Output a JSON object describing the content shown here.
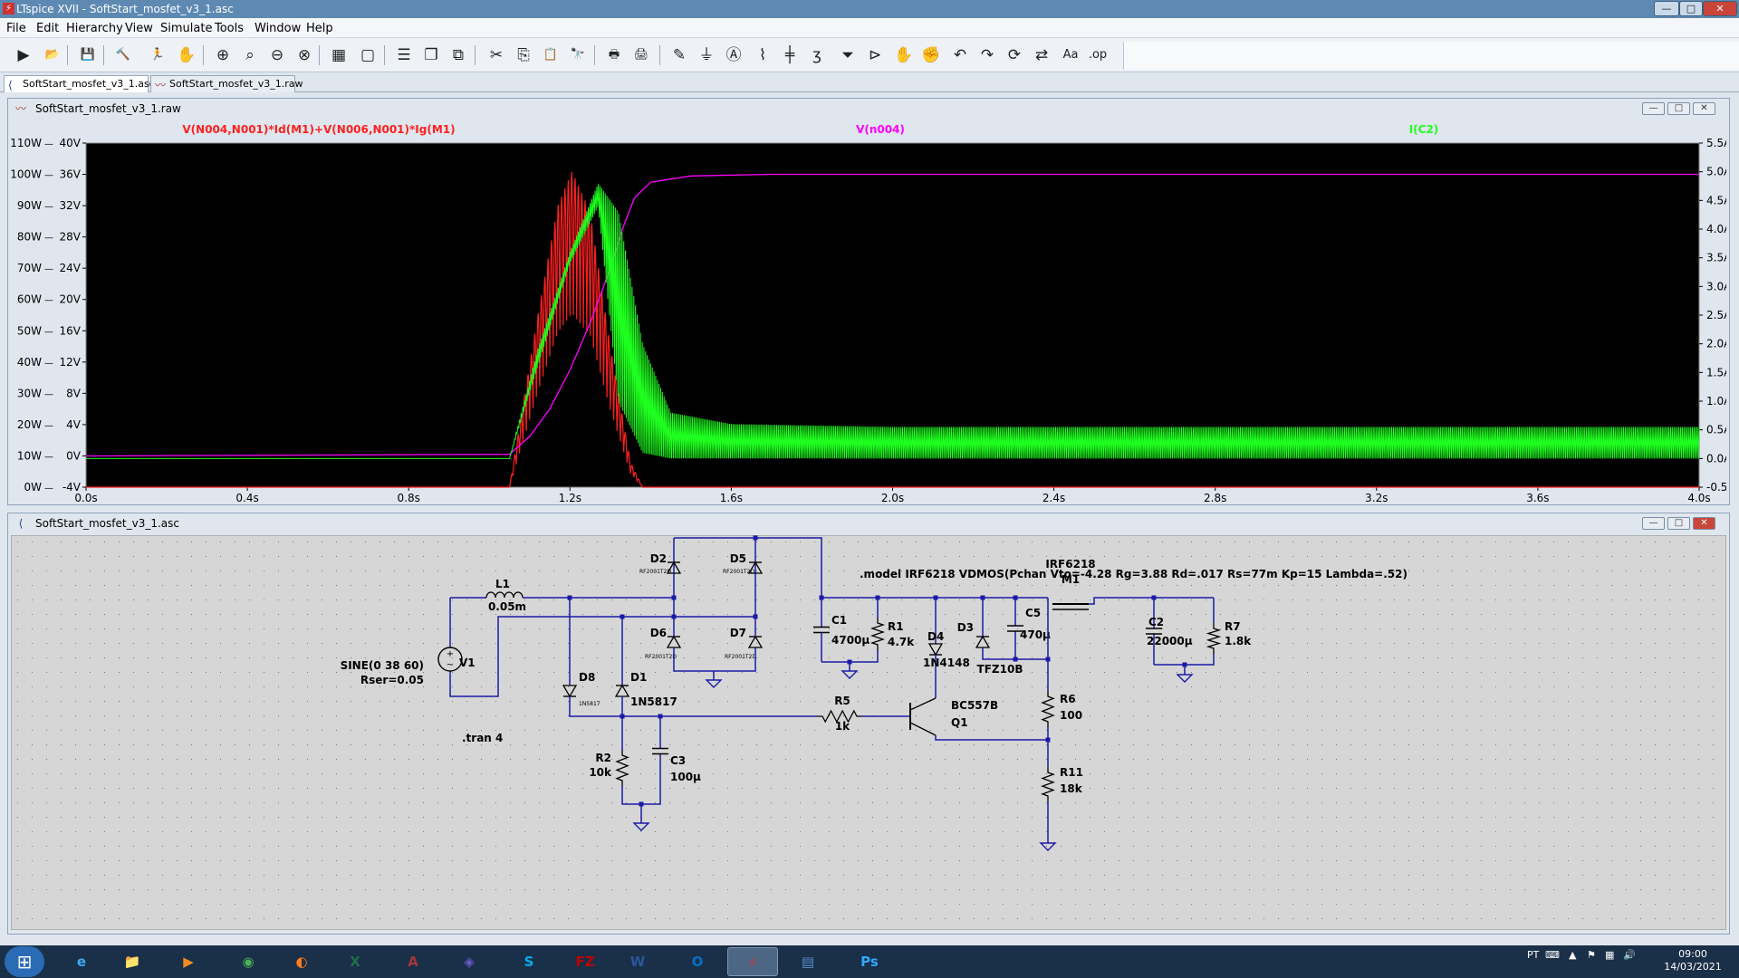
{
  "app": {
    "title": "LTspice XVII - SoftStart_mosfet_v3_1.asc",
    "icon": "ltspice-icon"
  },
  "window_controls": {
    "minimize": "—",
    "maximize": "□",
    "close": "✕"
  },
  "menu": [
    "File",
    "Edit",
    "Hierarchy",
    "View",
    "Simulate",
    "Tools",
    "Window",
    "Help"
  ],
  "toolbar": [
    {
      "name": "run-icon",
      "glyph": "▶"
    },
    {
      "name": "open-icon",
      "glyph": "📂"
    },
    {
      "name": "save-icon",
      "glyph": "💾"
    },
    {
      "name": "control-panel-icon",
      "glyph": "🔨"
    },
    {
      "name": "run-stop-icon",
      "glyph": "🏃"
    },
    {
      "name": "pan-icon",
      "glyph": "✋"
    },
    {
      "name": "zoom-in-icon",
      "glyph": "⊕"
    },
    {
      "name": "zoom-area-icon",
      "glyph": "⌕"
    },
    {
      "name": "zoom-out-icon",
      "glyph": "⊖"
    },
    {
      "name": "zoom-fit-icon",
      "glyph": "⊗"
    },
    {
      "name": "autorange-icon",
      "glyph": "▦"
    },
    {
      "name": "delete-plot-icon",
      "glyph": "▢"
    },
    {
      "name": "tile-horizontal-icon",
      "glyph": "☰"
    },
    {
      "name": "cascade-icon",
      "glyph": "❐"
    },
    {
      "name": "tile-vertical-icon",
      "glyph": "⧉"
    },
    {
      "name": "cut-icon",
      "glyph": "✂"
    },
    {
      "name": "copy-icon",
      "glyph": "⎘"
    },
    {
      "name": "paste-icon",
      "glyph": "📋"
    },
    {
      "name": "find-icon",
      "glyph": "🔭"
    },
    {
      "name": "print-icon",
      "glyph": "🖶"
    },
    {
      "name": "print-setup-icon",
      "glyph": "🖨"
    },
    {
      "name": "draw-wire-icon",
      "glyph": "✎"
    },
    {
      "name": "ground-icon",
      "glyph": "⏚"
    },
    {
      "name": "label-icon",
      "glyph": "Ⓐ"
    },
    {
      "name": "resistor-icon",
      "glyph": "⌇"
    },
    {
      "name": "capacitor-icon",
      "glyph": "╪"
    },
    {
      "name": "inductor-icon",
      "glyph": "ʒ"
    },
    {
      "name": "diode-icon",
      "glyph": "⏷"
    },
    {
      "name": "component-icon",
      "glyph": "⊳"
    },
    {
      "name": "move-icon",
      "glyph": "✋"
    },
    {
      "name": "drag-icon",
      "glyph": "✊"
    },
    {
      "name": "undo-icon",
      "glyph": "↶"
    },
    {
      "name": "redo-icon",
      "glyph": "↷"
    },
    {
      "name": "rotate-icon",
      "glyph": "⟳"
    },
    {
      "name": "mirror-icon",
      "glyph": "⇄"
    },
    {
      "name": "text-icon",
      "glyph": "Aa"
    },
    {
      "name": "spice-directive-icon",
      "glyph": ".op"
    }
  ],
  "tabs": [
    {
      "label": "SoftStart_mosfet_v3_1.asc",
      "active": true,
      "icon": "schematic-icon"
    },
    {
      "label": "SoftStart_mosfet_v3_1.raw",
      "active": false,
      "icon": "waveform-icon"
    }
  ],
  "plot_window": {
    "title": "SoftStart_mosfet_v3_1.raw"
  },
  "schematic_window": {
    "title": "SoftStart_mosfet_v3_1.asc"
  },
  "chart_data": {
    "type": "line",
    "title": "",
    "xlabel": "",
    "ylabel": "",
    "x_ticks": [
      "0.0s",
      "0.4s",
      "0.8s",
      "1.2s",
      "1.6s",
      "2.0s",
      "2.4s",
      "2.8s",
      "3.2s",
      "3.6s",
      "4.0s"
    ],
    "xlim": [
      0,
      4.0
    ],
    "y_left_ticks": [
      "0W",
      "10W",
      "20W",
      "30W",
      "40W",
      "50W",
      "60W",
      "70W",
      "80W",
      "90W",
      "100W",
      "110W"
    ],
    "y_left2_ticks": [
      "-4V",
      "0V",
      "4V",
      "8V",
      "12V",
      "16V",
      "20V",
      "24V",
      "28V",
      "32V",
      "36V",
      "40V"
    ],
    "y_right_ticks": [
      "-0.5A",
      "0.0A",
      "0.5A",
      "1.0A",
      "1.5A",
      "2.0A",
      "2.5A",
      "3.0A",
      "3.5A",
      "4.0A",
      "4.5A",
      "5.0A",
      "5.5A"
    ],
    "ylim_power": [
      0,
      110
    ],
    "ylim_voltage": [
      -4,
      40
    ],
    "ylim_current": [
      -0.5,
      5.5
    ],
    "grid": false,
    "background": "#000000",
    "series": [
      {
        "name": "V(N004,N001)*Id(M1)+V(N006,N001)*Ig(M1)",
        "color": "#ff2020",
        "axis": "power",
        "envelope_peak": [
          [
            1.05,
            0
          ],
          [
            1.12,
            55
          ],
          [
            1.17,
            90
          ],
          [
            1.205,
            101
          ],
          [
            1.25,
            88
          ],
          [
            1.3,
            45
          ],
          [
            1.35,
            8
          ],
          [
            1.38,
            0
          ]
        ]
      },
      {
        "name": "V(n004)",
        "color": "#ff00ff",
        "axis": "voltage",
        "x": [
          0,
          1.05,
          1.1,
          1.15,
          1.2,
          1.25,
          1.3,
          1.33,
          1.36,
          1.4,
          1.5,
          1.7,
          2.0,
          4.0
        ],
        "y": [
          0,
          0.2,
          2.5,
          6,
          11,
          17,
          24,
          29,
          33,
          35,
          35.8,
          36,
          36,
          36
        ]
      },
      {
        "name": "I(C2)",
        "color": "#1fff1f",
        "axis": "current",
        "envelope_peak": [
          [
            1.05,
            0
          ],
          [
            1.12,
            1.9
          ],
          [
            1.2,
            3.6
          ],
          [
            1.27,
            4.8
          ],
          [
            1.32,
            4.3
          ],
          [
            1.38,
            2.0
          ],
          [
            1.45,
            0.8
          ],
          [
            1.6,
            0.6
          ],
          [
            2.0,
            0.55
          ],
          [
            4.0,
            0.55
          ]
        ],
        "envelope_low": [
          [
            1.05,
            0
          ],
          [
            1.12,
            1.6
          ],
          [
            1.2,
            3.4
          ],
          [
            1.27,
            4.4
          ],
          [
            1.32,
            1.0
          ],
          [
            1.38,
            0.1
          ],
          [
            1.45,
            0.0
          ],
          [
            4.0,
            0.0
          ]
        ]
      }
    ]
  },
  "schematic": {
    "directive_model": ".model IRF6218 VDMOS(Pchan Vto=-4.28 Rg=3.88 Rd=.017 Rs=77m Kp=15 Lambda=.52)",
    "directive_tran": ".tran 4",
    "source": {
      "ref": "V1",
      "value1": "SINE(0 38 60)",
      "value2": "Rser=0.05"
    },
    "components": [
      {
        "ref": "L1",
        "value": "0.05m"
      },
      {
        "ref": "D2",
        "value": "RF2001T2D"
      },
      {
        "ref": "D5",
        "value": "RF2001T2D"
      },
      {
        "ref": "D6",
        "value": "RF2001T2D"
      },
      {
        "ref": "D7",
        "value": "RF2001T2D"
      },
      {
        "ref": "D8",
        "value": "1N5817"
      },
      {
        "ref": "D1",
        "value": "1N5817"
      },
      {
        "ref": "C1",
        "value": "4700µ"
      },
      {
        "ref": "R1",
        "value": "4.7k"
      },
      {
        "ref": "D4",
        "value": "1N4148"
      },
      {
        "ref": "D3",
        "value": "TFZ10B"
      },
      {
        "ref": "C5",
        "value": "470µ"
      },
      {
        "ref": "M1",
        "value": "IRF6218"
      },
      {
        "ref": "C2",
        "value": "22000µ"
      },
      {
        "ref": "R7",
        "value": "1.8k"
      },
      {
        "ref": "R5",
        "value": "1k"
      },
      {
        "ref": "Q1",
        "value": "BC557B"
      },
      {
        "ref": "R6",
        "value": "100"
      },
      {
        "ref": "R11",
        "value": "18k"
      },
      {
        "ref": "R2",
        "value": "10k"
      },
      {
        "ref": "C3",
        "value": "100µ"
      }
    ]
  },
  "taskbar": {
    "apps": [
      {
        "name": "ie-icon",
        "glyph": "e",
        "color": "#3fa9f5"
      },
      {
        "name": "explorer-icon",
        "glyph": "📁",
        "color": "#f2c14e"
      },
      {
        "name": "media-player-icon",
        "glyph": "▶",
        "color": "#f08a24"
      },
      {
        "name": "chrome-icon",
        "glyph": "◉",
        "color": "#4caf50"
      },
      {
        "name": "firefox-icon",
        "glyph": "◐",
        "color": "#ff7b1c"
      },
      {
        "name": "excel-icon",
        "glyph": "X",
        "color": "#1e7145"
      },
      {
        "name": "access-icon",
        "glyph": "A",
        "color": "#a4373a"
      },
      {
        "name": "paint-icon",
        "glyph": "◈",
        "color": "#6a5acd"
      },
      {
        "name": "skype-icon",
        "glyph": "S",
        "color": "#00aff0"
      },
      {
        "name": "filezilla-icon",
        "glyph": "FZ",
        "color": "#bf0000"
      },
      {
        "name": "word-icon",
        "glyph": "W",
        "color": "#2b579a"
      },
      {
        "name": "outlook-icon",
        "glyph": "O",
        "color": "#0072c6"
      },
      {
        "name": "ltspice-taskbar-icon",
        "glyph": "⚡",
        "color": "#c23b3b",
        "active": true
      },
      {
        "name": "control-panel-taskbar-icon",
        "glyph": "▤",
        "color": "#5a8fc7"
      },
      {
        "name": "photoshop-icon",
        "glyph": "Ps",
        "color": "#31a8ff"
      }
    ],
    "language": "PT",
    "time": "09:00",
    "date": "14/03/2021"
  }
}
